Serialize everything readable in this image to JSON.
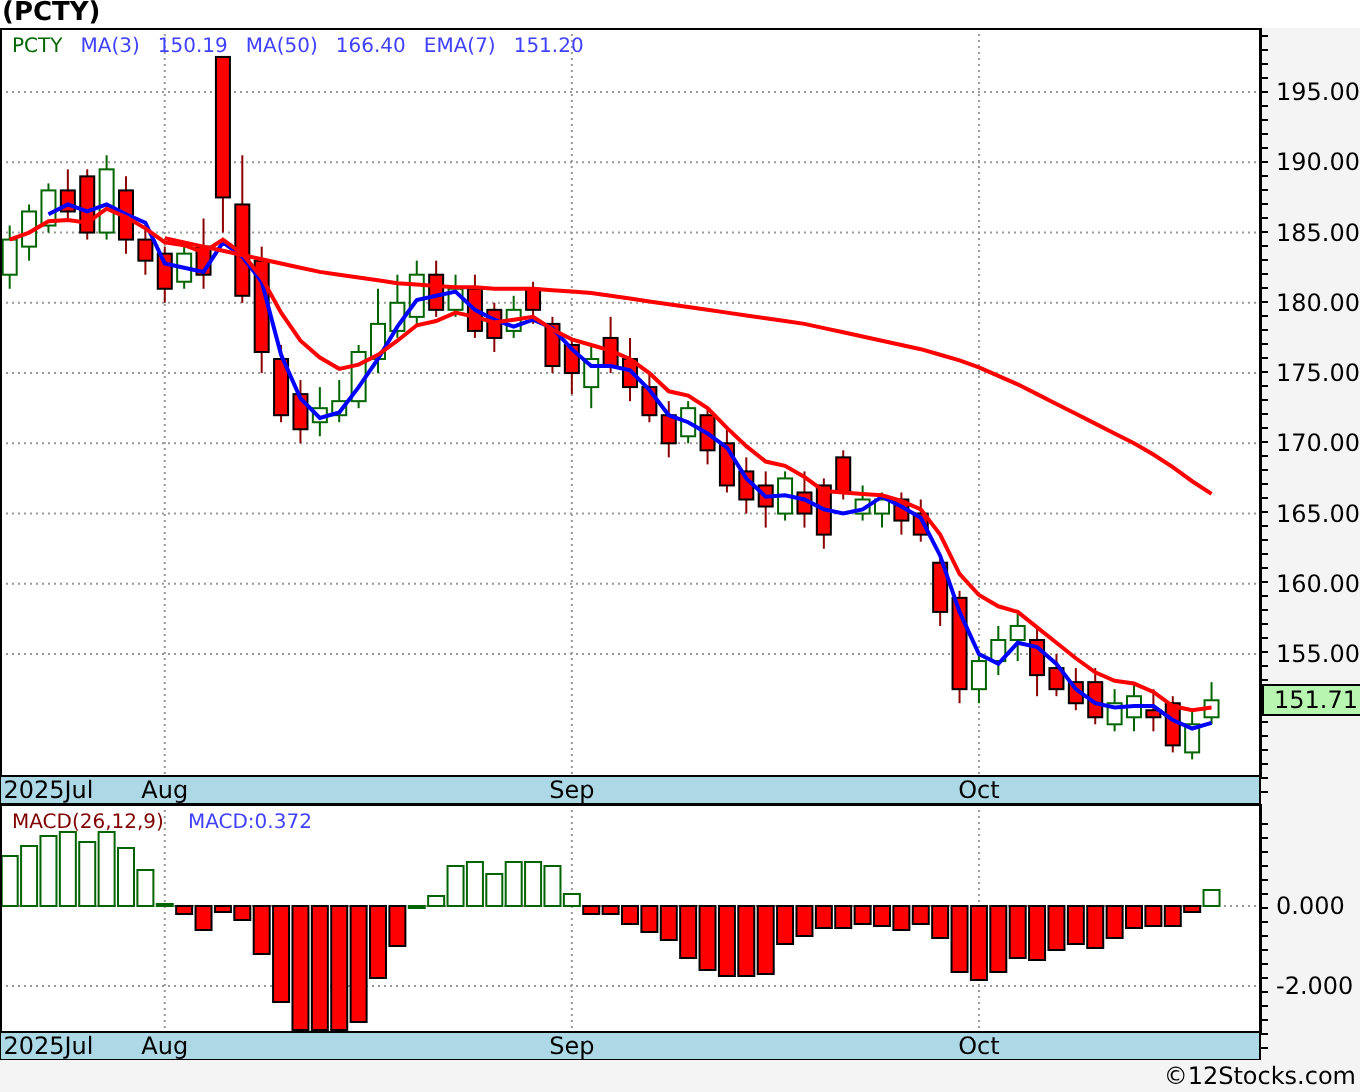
{
  "title": "(PCTY)",
  "price_chart": {
    "legend_values": [
      "150.19",
      "166.40",
      "151.20"
    ],
    "last_price": "151.71",
    "chart_data": {
      "type": "candlestick",
      "grid": true,
      "ylim": [
        146.32,
        199.56
      ],
      "categories": [
        null,
        null,
        "2025Jul",
        null,
        null,
        null,
        null,
        null,
        "Aug",
        null,
        null,
        null,
        null,
        null,
        null,
        null,
        null,
        null,
        null,
        null,
        null,
        null,
        null,
        null,
        null,
        null,
        null,
        null,
        null,
        "Sep",
        null,
        null,
        null,
        null,
        null,
        null,
        null,
        null,
        null,
        null,
        null,
        null,
        null,
        null,
        null,
        null,
        null,
        null,
        null,
        null,
        "Oct",
        null,
        null,
        null,
        null,
        null,
        null,
        null,
        null,
        null,
        null,
        null,
        null,
        null,
        null
      ],
      "yticks": [
        {
          "value": 155,
          "label": "155.00"
        },
        {
          "value": 160,
          "label": "160.00"
        },
        {
          "value": 165,
          "label": "165.00"
        },
        {
          "value": 170,
          "label": "170.00"
        },
        {
          "value": 175,
          "label": "175.00"
        },
        {
          "value": 180,
          "label": "180.00"
        },
        {
          "value": 185,
          "label": "185.00"
        },
        {
          "value": 190,
          "label": "190.00"
        },
        {
          "value": 195,
          "label": "195.00"
        }
      ],
      "series": [
        {
          "name": "PCTY",
          "ohlc": [
            [
              182,
              185.5,
              181,
              184.5
            ],
            [
              184,
              187,
              183,
              186.5
            ],
            [
              185.5,
              188.5,
              185,
              188
            ],
            [
              188,
              189.5,
              186,
              186.5
            ],
            [
              189,
              189.5,
              184.5,
              185
            ],
            [
              185,
              190.5,
              184.5,
              189.5
            ],
            [
              188,
              189,
              183.5,
              184.5
            ],
            [
              184.5,
              185.5,
              182,
              183
            ],
            [
              183.5,
              184,
              180,
              181
            ],
            [
              181.5,
              184,
              181,
              183.5
            ],
            [
              184,
              186,
              181,
              182
            ],
            [
              197.5,
              197.5,
              185,
              187.5
            ],
            [
              187,
              190.5,
              180,
              180.5
            ],
            [
              183,
              184,
              175,
              176.5
            ],
            [
              176,
              177,
              171.5,
              172
            ],
            [
              173.5,
              174.5,
              170,
              171
            ],
            [
              171.5,
              174,
              170.5,
              172.5
            ],
            [
              172,
              174.5,
              171.5,
              173
            ],
            [
              173,
              177,
              172.5,
              176.5
            ],
            [
              176,
              181,
              175,
              178.5
            ],
            [
              178,
              182,
              177.5,
              180
            ],
            [
              179,
              183,
              178.5,
              182
            ],
            [
              182,
              183,
              179,
              179.5
            ],
            [
              179.5,
              182,
              179,
              181
            ],
            [
              181,
              182,
              177.5,
              178
            ],
            [
              179.5,
              180,
              176.5,
              177.5
            ],
            [
              178,
              180.5,
              177.5,
              179.5
            ],
            [
              181,
              181.5,
              178.5,
              179.5
            ],
            [
              178.5,
              179,
              175,
              175.5
            ],
            [
              177,
              177.5,
              173.5,
              175
            ],
            [
              174,
              177,
              172.5,
              176
            ],
            [
              177.5,
              179,
              175,
              175.5
            ],
            [
              176,
              177.5,
              173,
              174
            ],
            [
              174,
              175,
              171.5,
              172
            ],
            [
              172,
              173,
              169,
              170
            ],
            [
              170.5,
              173,
              170,
              172.5
            ],
            [
              172,
              172.5,
              168.5,
              169.5
            ],
            [
              170,
              171,
              166.5,
              167
            ],
            [
              168,
              169,
              165,
              166
            ],
            [
              167,
              168,
              164,
              165.5
            ],
            [
              165,
              168,
              164.5,
              167.5
            ],
            [
              166.5,
              168,
              164,
              165
            ],
            [
              167,
              167.5,
              162.5,
              163.5
            ],
            [
              169,
              169.5,
              166,
              166.5
            ],
            [
              165,
              167,
              164.5,
              166
            ],
            [
              165,
              166.5,
              164,
              166
            ],
            [
              166,
              166.5,
              163.5,
              164.5
            ],
            [
              165,
              166,
              163,
              163.5
            ],
            [
              161.5,
              162,
              157,
              158
            ],
            [
              159,
              159.5,
              151.5,
              152.5
            ],
            [
              152.5,
              155,
              151.5,
              154.5
            ],
            [
              154.5,
              157,
              153.5,
              156
            ],
            [
              156,
              158,
              154.5,
              157
            ],
            [
              156,
              157,
              152,
              153.5
            ],
            [
              154,
              155,
              152,
              152.5
            ],
            [
              153,
              154,
              151,
              151.5
            ],
            [
              153,
              154,
              150,
              150.5
            ],
            [
              150,
              152.5,
              149.5,
              151.5
            ],
            [
              150.5,
              153,
              149.5,
              152
            ],
            [
              151,
              152.5,
              149.5,
              150.5
            ],
            [
              151.5,
              152,
              148,
              148.5
            ],
            [
              148,
              151,
              147.5,
              150
            ],
            [
              150.5,
              153,
              150,
              151.71
            ],
            null,
            null
          ]
        },
        {
          "name": "MA(3)",
          "type": "line",
          "color": "#0000ff",
          "values": [
            null,
            null,
            186.3,
            187,
            186.5,
            187,
            186.3,
            185.7,
            182.8,
            182.5,
            182.2,
            184.3,
            183.3,
            181.5,
            176.3,
            173.2,
            171.8,
            172.2,
            174,
            176,
            178.3,
            180.2,
            180.5,
            180.8,
            179.5,
            178.8,
            178.3,
            178.8,
            178.2,
            176.7,
            175.5,
            175.5,
            175.2,
            173.8,
            172,
            171.5,
            170.7,
            169.7,
            167.5,
            166.2,
            166.3,
            166,
            165.3,
            165,
            165.3,
            166.2,
            165.5,
            164.7,
            162,
            158,
            155,
            154.3,
            155.8,
            155.5,
            154.3,
            152.5,
            151.5,
            151.2,
            151.3,
            151.3,
            150.3,
            149.7,
            150.1,
            null,
            null
          ]
        },
        {
          "name": "MA(50)",
          "type": "line",
          "color": "#ff0000",
          "values": [
            null,
            null,
            null,
            null,
            null,
            null,
            null,
            null,
            184.6,
            184.3,
            184.0,
            183.7,
            183.4,
            183.1,
            182.8,
            182.5,
            182.2,
            182.0,
            181.8,
            181.6,
            181.4,
            181.3,
            181.2,
            181.1,
            181.1,
            181.0,
            181.0,
            181.0,
            180.9,
            180.8,
            180.7,
            180.5,
            180.3,
            180.1,
            179.9,
            179.7,
            179.5,
            179.3,
            179.1,
            178.9,
            178.7,
            178.5,
            178.2,
            177.9,
            177.6,
            177.3,
            177.0,
            176.7,
            176.3,
            175.9,
            175.4,
            174.8,
            174.2,
            173.5,
            172.8,
            172.1,
            171.4,
            170.7,
            170.0,
            169.2,
            168.3,
            167.3,
            166.4,
            null,
            null
          ]
        },
        {
          "name": "EMA(7)",
          "type": "line",
          "color": "#ff0000",
          "values": [
            184.5,
            185,
            185.8,
            185.9,
            185.7,
            186.7,
            186.1,
            185.3,
            184.3,
            184.1,
            183.6,
            184.5,
            183.5,
            181.8,
            179.3,
            177.3,
            176.1,
            175.3,
            175.6,
            176.3,
            177.3,
            178.4,
            178.7,
            179.3,
            179,
            178.6,
            178.8,
            179,
            178.1,
            177.4,
            177,
            176.6,
            176,
            175,
            173.7,
            173.4,
            172.5,
            171.1,
            169.8,
            168.7,
            168.4,
            167.6,
            166.6,
            166.5,
            166.4,
            166.3,
            165.9,
            165.3,
            163.5,
            160.7,
            159.2,
            158.4,
            158,
            156.9,
            155.8,
            154.7,
            153.7,
            153.1,
            152.9,
            152.3,
            151.3,
            151,
            151.2,
            null,
            null
          ]
        }
      ]
    }
  },
  "macd_chart": {
    "reading": "MACD:0.372",
    "chart_data": {
      "type": "bar",
      "grid": true,
      "ylim": [
        -3.15,
        2.55
      ],
      "categories": [
        null,
        null,
        "2025Jul",
        null,
        null,
        null,
        null,
        null,
        "Aug",
        null,
        null,
        null,
        null,
        null,
        null,
        null,
        null,
        null,
        null,
        null,
        null,
        null,
        null,
        null,
        null,
        null,
        null,
        null,
        null,
        "Sep",
        null,
        null,
        null,
        null,
        null,
        null,
        null,
        null,
        null,
        null,
        null,
        null,
        null,
        null,
        null,
        null,
        null,
        null,
        null,
        null,
        "Oct",
        null,
        null,
        null,
        null,
        null,
        null,
        null,
        null,
        null,
        null,
        null,
        null,
        null,
        null
      ],
      "yticks": [
        {
          "value": 0,
          "label": "0.000"
        },
        {
          "value": -2,
          "label": "-2.000"
        }
      ],
      "series": [
        {
          "name": "MACD(26,12,9)",
          "values": [
            1.25,
            1.5,
            1.75,
            1.85,
            1.6,
            1.85,
            1.45,
            0.9,
            0.05,
            -0.2,
            -0.6,
            -0.15,
            -0.35,
            -1.2,
            -2.4,
            -3.1,
            -3.1,
            -3.1,
            -2.9,
            -1.8,
            -1.0,
            0,
            0.25,
            1.0,
            1.1,
            0.8,
            1.1,
            1.1,
            1.0,
            0.3,
            -0.2,
            -0.2,
            -0.45,
            -0.65,
            -0.85,
            -1.3,
            -1.6,
            -1.75,
            -1.75,
            -1.7,
            -0.95,
            -0.75,
            -0.55,
            -0.55,
            -0.45,
            -0.5,
            -0.6,
            -0.45,
            -0.8,
            -1.65,
            -1.85,
            -1.65,
            -1.3,
            -1.35,
            -1.1,
            -0.95,
            -1.05,
            -0.8,
            -0.55,
            -0.5,
            -0.5,
            -0.15,
            0.4,
            null,
            null
          ]
        }
      ]
    }
  },
  "footer": "©12Stocks.com"
}
